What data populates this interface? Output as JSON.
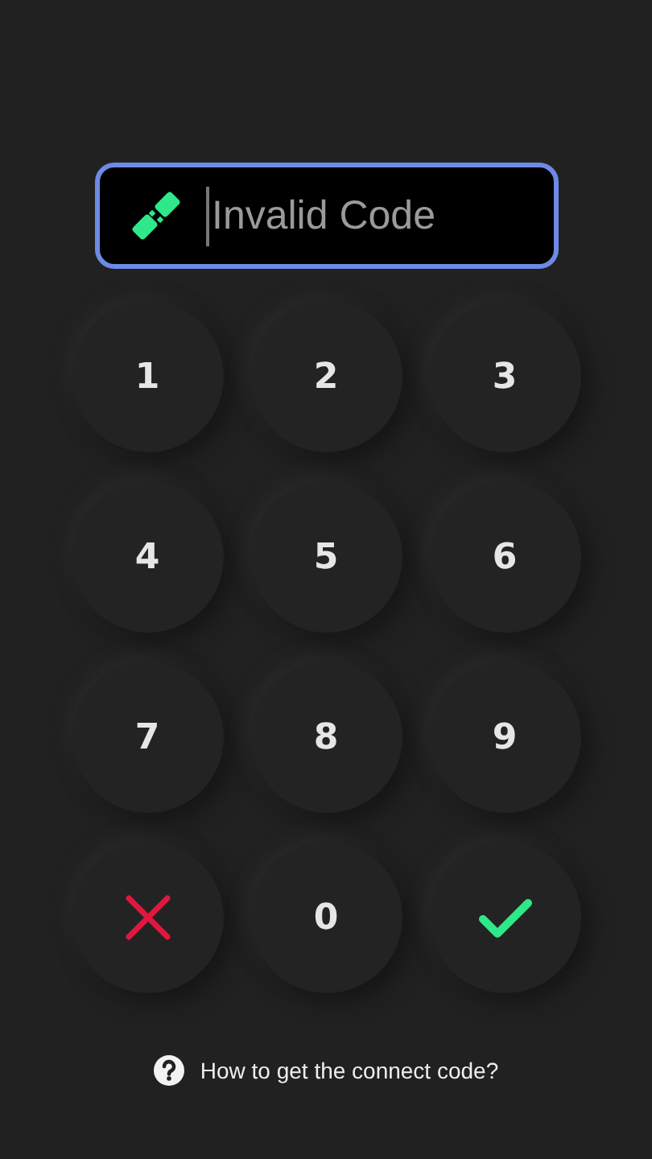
{
  "code_field": {
    "placeholder": "Invalid Code",
    "focused": true
  },
  "keypad": [
    {
      "kind": "digit",
      "label": "1"
    },
    {
      "kind": "digit",
      "label": "2"
    },
    {
      "kind": "digit",
      "label": "3"
    },
    {
      "kind": "digit",
      "label": "4"
    },
    {
      "kind": "digit",
      "label": "5"
    },
    {
      "kind": "digit",
      "label": "6"
    },
    {
      "kind": "digit",
      "label": "7"
    },
    {
      "kind": "digit",
      "label": "8"
    },
    {
      "kind": "digit",
      "label": "9"
    },
    {
      "kind": "clear"
    },
    {
      "kind": "digit",
      "label": "0"
    },
    {
      "kind": "confirm"
    }
  ],
  "help_link": "How to get the connect code?"
}
